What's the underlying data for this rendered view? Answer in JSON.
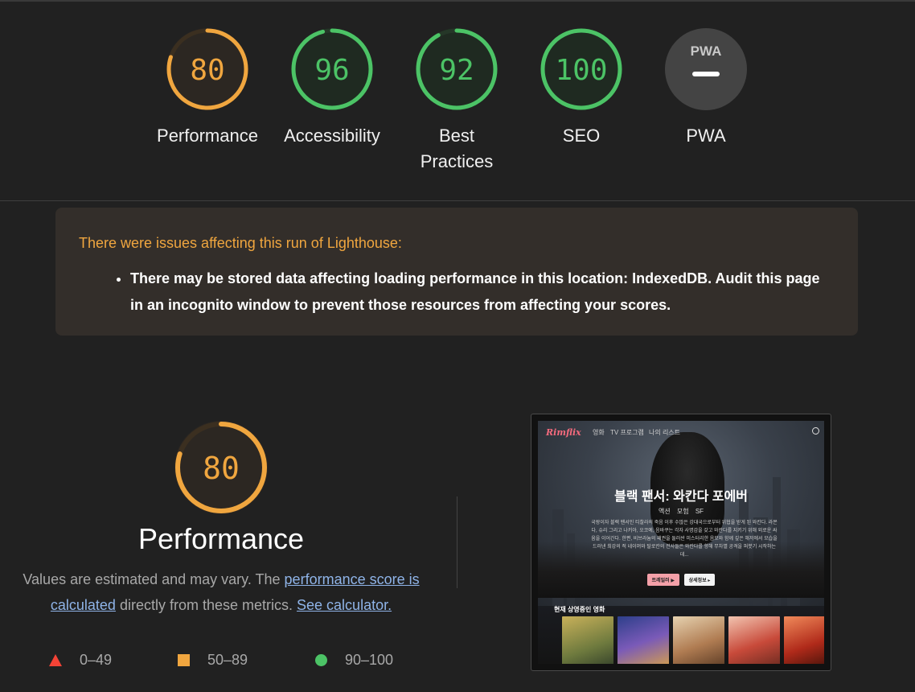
{
  "scores": [
    {
      "value": "80",
      "fraction": 0.8,
      "label": "Performance",
      "color": "#f0a63f",
      "track": "#3b2f20",
      "fill": "#2c2722"
    },
    {
      "value": "96",
      "fraction": 0.96,
      "label": "Accessibility",
      "color": "#4cc366",
      "track": "#253728",
      "fill": "#1f2a21"
    },
    {
      "value": "92",
      "fraction": 0.92,
      "label": "Best Practices",
      "color": "#4cc366",
      "track": "#253728",
      "fill": "#1f2a21"
    },
    {
      "value": "100",
      "fraction": 1.0,
      "label": "SEO",
      "color": "#4cc366",
      "track": "#253728",
      "fill": "#1f2a21"
    }
  ],
  "pwa": {
    "label": "PWA",
    "badge_text": "PWA"
  },
  "warning": {
    "title": "There were issues affecting this run of Lighthouse:",
    "items": [
      "There may be stored data affecting loading performance in this location: IndexedDB. Audit this page in an incognito window to prevent those resources from affecting your scores."
    ]
  },
  "performance": {
    "score": "80",
    "fraction": 0.8,
    "title": "Performance",
    "desc_prefix": "Values are estimated and may vary. The ",
    "link_score": "performance score is calculated",
    "desc_middle": " directly from these metrics. ",
    "link_calculator": "See calculator."
  },
  "legend": [
    {
      "icon": "fail-triangle-icon",
      "range": "0–49",
      "color": "#f44336"
    },
    {
      "icon": "average-square-icon",
      "range": "50–89",
      "color": "#f0a63f"
    },
    {
      "icon": "pass-circle-icon",
      "range": "90–100",
      "color": "#4cc366"
    }
  ],
  "screenshot": {
    "logo": "Rimflix",
    "nav": [
      "영화",
      "TV 프로그램",
      "나의 리스트"
    ],
    "hero_title": "블랙 팬서: 와칸다 포에버",
    "genres": "액션 모험 SF",
    "hero_desc": "국왕이자 블랙 팬서인 티찰라의 죽음 이후 수많은 강대국으로부터 위협을 받게 된 와칸다. 라몬다, 슈리 그리고 나키아, 오코예, 음바쿠는 각자 사명감을 갖고 와칸다를 지키기 위해 외로운 싸움을 이어간다. 한편, 비브라늄의 패권을 둘러싼 미스터리한 음모와 함께 깊은 해저에서 모습을 드러낸 최강의 적 네이머와 탈로칸의 전사들은 와칸다를 향해 무차별 공격을 퍼붓기 시작하는데...",
    "btn_trailer": "트레일러 ▶",
    "btn_detail": "상세정보 ▸",
    "row_title": "현재 상영중인 영화"
  }
}
